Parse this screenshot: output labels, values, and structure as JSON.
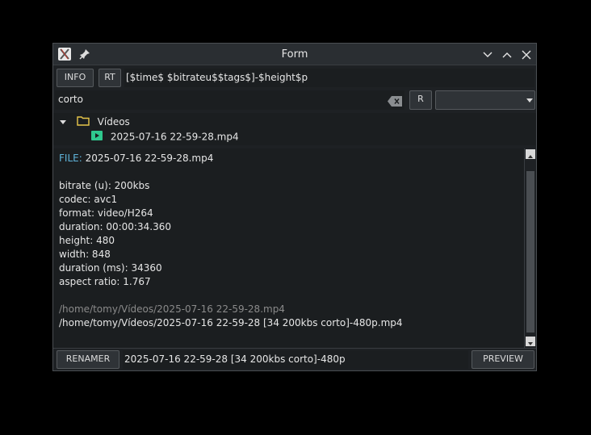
{
  "window": {
    "title": "Form"
  },
  "toolbar": {
    "info_label": "INFO",
    "rt_label": "RT",
    "pattern_value": "[$time$ $bitrateu$$tags$]-$height$p"
  },
  "search": {
    "value": "corto",
    "r_label": "R"
  },
  "tree": {
    "folder_label": "Vídeos",
    "file_label": "2025-07-16 22-59-28.mp4"
  },
  "info": {
    "file_key": "FILE:",
    "file_value": "2025-07-16 22-59-28.mp4",
    "lines": [
      "bitrate (u): 200kbs",
      "codec: avc1",
      "format: video/H264",
      "duration: 00:00:34.360",
      "height: 480",
      "width: 848",
      "duration (ms): 34360",
      "aspect ratio: 1.767"
    ],
    "old_path": "/home/tomy/Vídeos/2025-07-16 22-59-28.mp4",
    "new_path": "/home/tomy/Vídeos/2025-07-16 22-59-28 [34 200kbs corto]-480p.mp4"
  },
  "bottom": {
    "renamer_label": "RENAMER",
    "new_name": "2025-07-16 22-59-28 [34 200kbs corto]-480p",
    "preview_label": "PREVIEW"
  },
  "colors": {
    "file_key": "#5fb3d9",
    "old_path": "#8a8a8a",
    "video_icon": "#2fc98e",
    "folder_icon": "#e8c64a"
  }
}
